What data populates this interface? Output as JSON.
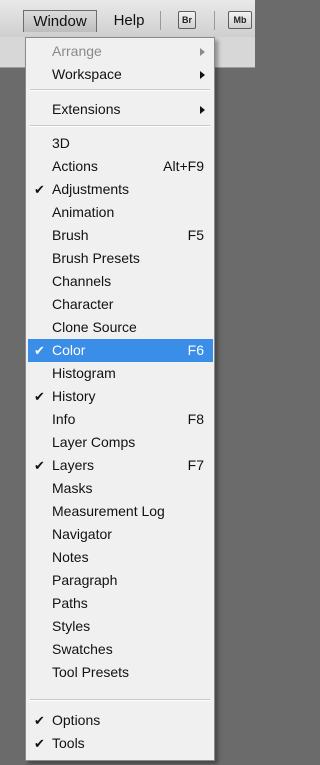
{
  "menubar": {
    "window_label": "Window",
    "help_label": "Help",
    "bridge_badge": "Br",
    "minibridge_badge": "Mb"
  },
  "dropdown": {
    "selection_color": "#3a8ee8",
    "items": [
      {
        "label": "Arrange",
        "shortcut": "",
        "checked": false,
        "submenu": true,
        "disabled": true
      },
      {
        "label": "Workspace",
        "shortcut": "",
        "checked": false,
        "submenu": true,
        "disabled": false
      },
      {
        "label": "Extensions",
        "shortcut": "",
        "checked": false,
        "submenu": true,
        "disabled": false
      },
      {
        "label": "3D",
        "shortcut": "",
        "checked": false
      },
      {
        "label": "Actions",
        "shortcut": "Alt+F9",
        "checked": false
      },
      {
        "label": "Adjustments",
        "shortcut": "",
        "checked": true
      },
      {
        "label": "Animation",
        "shortcut": "",
        "checked": false
      },
      {
        "label": "Brush",
        "shortcut": "F5",
        "checked": false
      },
      {
        "label": "Brush Presets",
        "shortcut": "",
        "checked": false
      },
      {
        "label": "Channels",
        "shortcut": "",
        "checked": false
      },
      {
        "label": "Character",
        "shortcut": "",
        "checked": false
      },
      {
        "label": "Clone Source",
        "shortcut": "",
        "checked": false
      },
      {
        "label": "Color",
        "shortcut": "F6",
        "checked": true,
        "selected": true
      },
      {
        "label": "Histogram",
        "shortcut": "",
        "checked": false
      },
      {
        "label": "History",
        "shortcut": "",
        "checked": true
      },
      {
        "label": "Info",
        "shortcut": "F8",
        "checked": false
      },
      {
        "label": "Layer Comps",
        "shortcut": "",
        "checked": false
      },
      {
        "label": "Layers",
        "shortcut": "F7",
        "checked": true
      },
      {
        "label": "Masks",
        "shortcut": "",
        "checked": false
      },
      {
        "label": "Measurement Log",
        "shortcut": "",
        "checked": false
      },
      {
        "label": "Navigator",
        "shortcut": "",
        "checked": false
      },
      {
        "label": "Notes",
        "shortcut": "",
        "checked": false
      },
      {
        "label": "Paragraph",
        "shortcut": "",
        "checked": false
      },
      {
        "label": "Paths",
        "shortcut": "",
        "checked": false
      },
      {
        "label": "Styles",
        "shortcut": "",
        "checked": false
      },
      {
        "label": "Swatches",
        "shortcut": "",
        "checked": false
      },
      {
        "label": "Tool Presets",
        "shortcut": "",
        "checked": false
      },
      {
        "label": "Options",
        "shortcut": "",
        "checked": true
      },
      {
        "label": "Tools",
        "shortcut": "",
        "checked": true
      }
    ]
  }
}
